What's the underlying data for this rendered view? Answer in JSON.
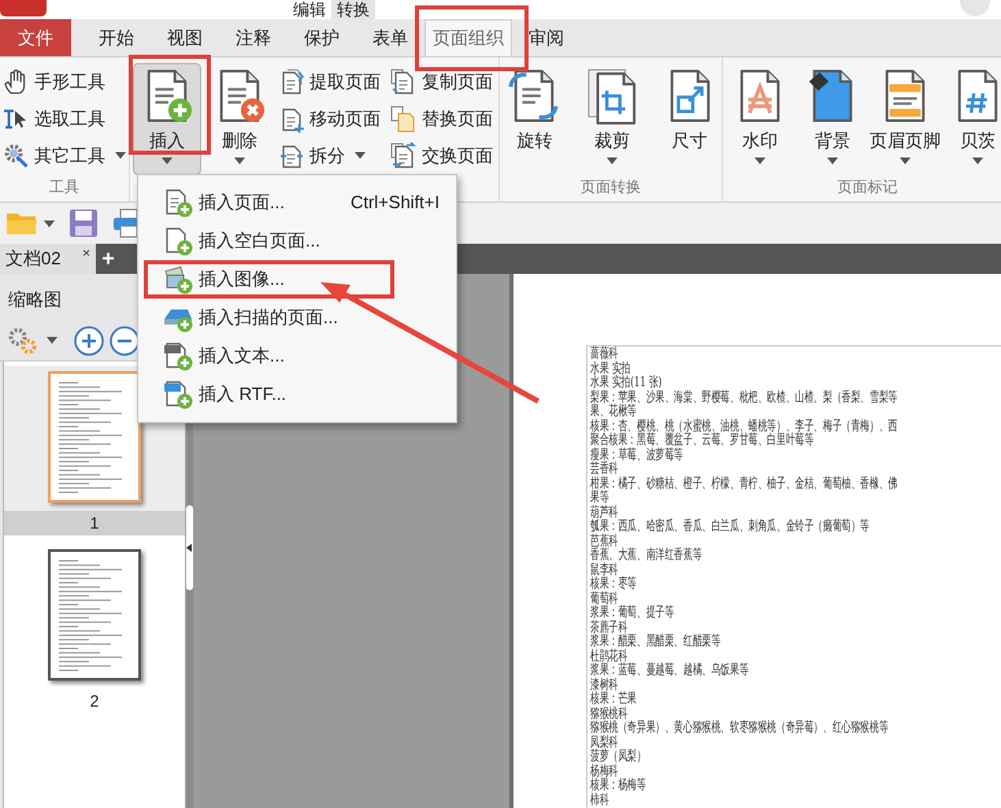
{
  "title_bar": {
    "tabs": [
      {
        "label": "编辑",
        "selected": false
      },
      {
        "label": "转换",
        "selected": true
      }
    ]
  },
  "file_button": {
    "label": "文件"
  },
  "ribbon_tabs": [
    {
      "label": "开始",
      "selected": false
    },
    {
      "label": "视图",
      "selected": false
    },
    {
      "label": "注释",
      "selected": false
    },
    {
      "label": "保护",
      "selected": false
    },
    {
      "label": "表单",
      "selected": false
    },
    {
      "label": "页面组织",
      "selected": true
    },
    {
      "label": "审阅",
      "selected": false
    }
  ],
  "ribbon_groups": [
    {
      "caption": "工具",
      "small_buttons": [
        {
          "label": "手形工具",
          "kind": "hand",
          "dropdown": false,
          "pressed": false
        },
        {
          "label": "选取工具",
          "kind": "select",
          "dropdown": false,
          "pressed": false
        },
        {
          "label": "其它工具",
          "kind": "gear",
          "dropdown": true,
          "pressed": false
        }
      ]
    },
    {
      "large_buttons": [
        {
          "label": "插入",
          "kind": "insert",
          "dropdown": true,
          "pressed": true
        },
        {
          "label": "删除",
          "kind": "delete",
          "dropdown": true,
          "pressed": false
        }
      ],
      "small_buttons": [
        {
          "label": "提取页面",
          "kind": "extract",
          "dropdown": false,
          "pressed": false
        },
        {
          "label": "移动页面",
          "kind": "move",
          "dropdown": false,
          "pressed": false
        },
        {
          "label": "拆分",
          "kind": "split",
          "dropdown": true,
          "pressed": false
        },
        {
          "label": "复制页面",
          "kind": "copy",
          "dropdown": false,
          "pressed": false
        },
        {
          "label": "替换页面",
          "kind": "replace",
          "dropdown": false,
          "pressed": false
        },
        {
          "label": "交换页面",
          "kind": "swap",
          "dropdown": false,
          "pressed": false
        }
      ]
    },
    {
      "caption": "页面转换",
      "large_buttons": [
        {
          "label": "旋转",
          "kind": "rotate",
          "dropdown": false,
          "pressed": false
        },
        {
          "label": "裁剪",
          "kind": "crop",
          "dropdown": true,
          "pressed": false
        },
        {
          "label": "尺寸",
          "kind": "size",
          "dropdown": false,
          "pressed": false
        }
      ]
    },
    {
      "caption": "页面标记",
      "large_buttons": [
        {
          "label": "水印",
          "kind": "watermark",
          "dropdown": true,
          "pressed": false
        },
        {
          "label": "背景",
          "kind": "background",
          "dropdown": true,
          "pressed": false
        },
        {
          "label": "页眉页脚",
          "kind": "headerfooter",
          "dropdown": true,
          "pressed": false
        },
        {
          "label": "贝茨",
          "kind": "bates",
          "dropdown": true,
          "pressed": false
        }
      ]
    }
  ],
  "document_tabs": [
    {
      "label": "文档02",
      "close": "×",
      "selected": true
    }
  ],
  "new_tab": "+",
  "thumbnails": {
    "title": "缩略图",
    "pages": [
      {
        "label": "1",
        "selected": true
      },
      {
        "label": "2",
        "selected": false
      }
    ]
  },
  "insert_menu": {
    "items": [
      {
        "label": "插入页面...",
        "shortcut": "Ctrl+Shift+I",
        "kind": "page"
      },
      {
        "label": "插入空白页面...",
        "kind": "blank"
      },
      {
        "label": "插入图像...",
        "kind": "image"
      },
      {
        "label": "插入扫描的页面...",
        "kind": "scan"
      },
      {
        "label": "插入文本...",
        "kind": "text"
      },
      {
        "label": "插入 RTF...",
        "kind": "rtf"
      }
    ]
  },
  "document": {
    "lines": [
      "蔷薇科",
      "水果 实拍",
      "水果 实拍(11 张)",
      "梨果：苹果、沙果、海棠、野樱莓、枇杷、欧楂、山楂、梨（香梨、雪梨等",
      "果、花楸等",
      "核果：杏、樱桃、桃（水蜜桃、油桃、蟠桃等）、李子、梅子（青梅）、西",
      "聚合核果：黑莓、覆盆子、云莓、罗甘莓、白里叶莓等",
      "瘦果：草莓、波萝莓等",
      "芸香科",
      "柑果：橘子、砂糖桔、橙子、柠檬、青柠、柚子、金桔、葡萄柚、香橼、佛",
      "果等",
      "葫芦科",
      "瓠果：西瓜、哈密瓜、香瓜、白兰瓜、刺角瓜、金铃子（癞葡萄）等",
      "芭蕉科",
      "香蕉、大蕉、南洋红香蕉等",
      "鼠李科",
      "核果：枣等",
      "葡萄科",
      "浆果：葡萄、提子等",
      "茶藨子科",
      "浆果：醋栗、黑醋栗、红醋栗等",
      "杜鹃花科",
      "浆果：蓝莓、蔓越莓、越橘、乌饭果等",
      "漆树科",
      "核果：芒果",
      "猕猴桃科",
      "猕猴桃（奇异果）、黄心猕猴桃、软枣猕猴桃（奇异莓）、红心猕猴桃等",
      "凤梨科",
      "菠萝（凤梨）",
      "杨梅科",
      "核果：杨梅等",
      "柿科"
    ]
  }
}
